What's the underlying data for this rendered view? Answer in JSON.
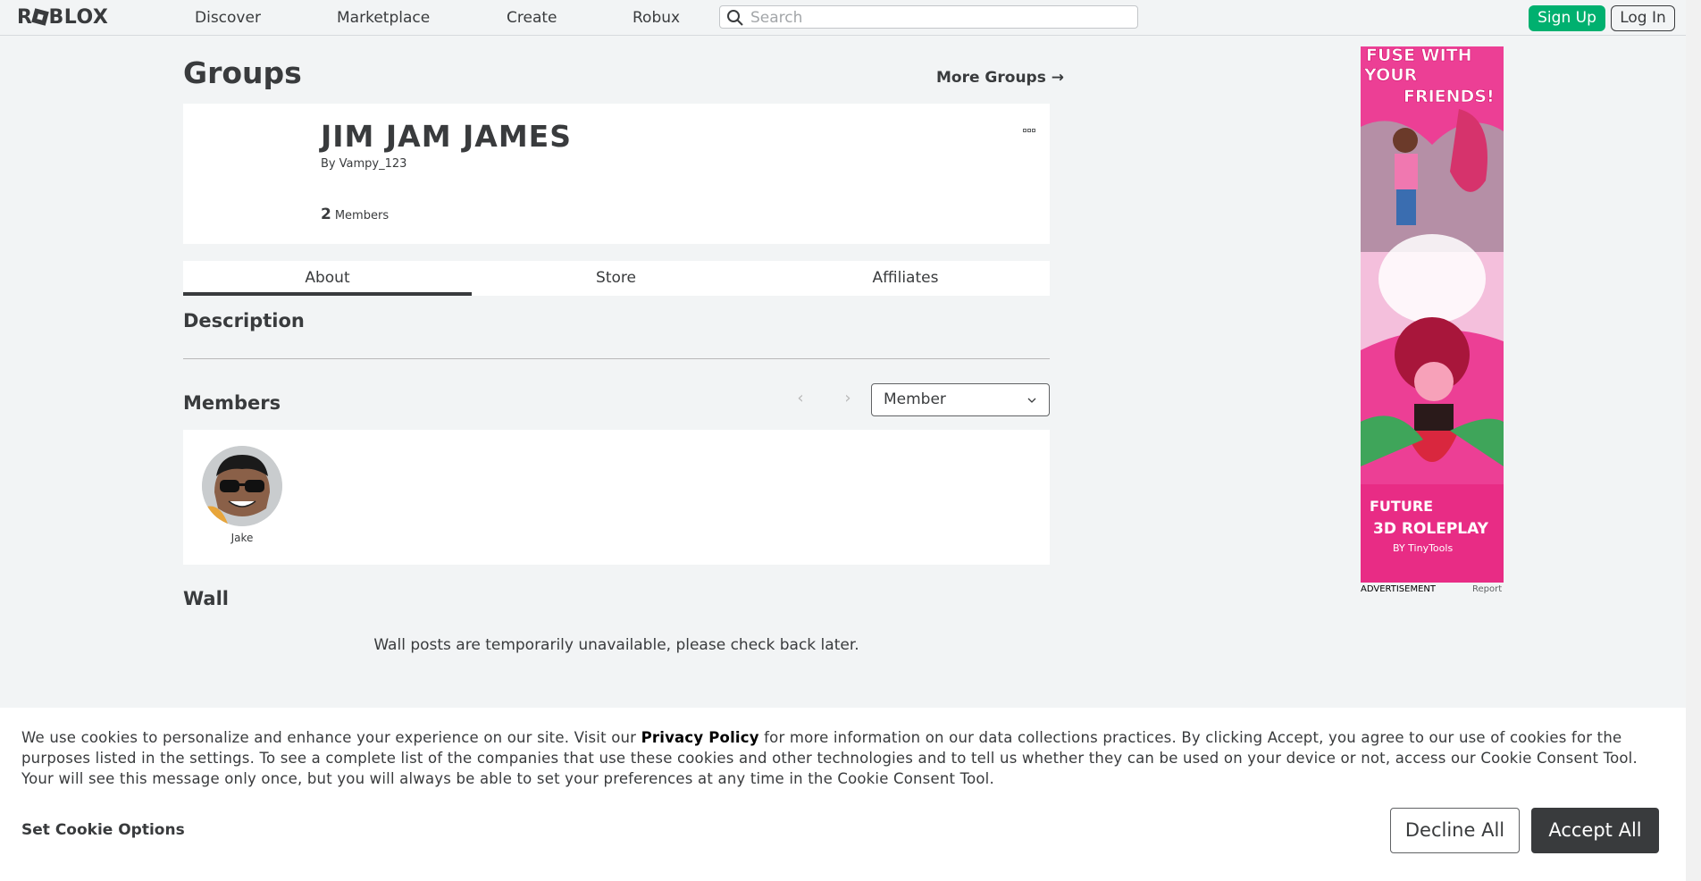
{
  "nav": {
    "logo": "ROBLOX",
    "links": [
      "Discover",
      "Marketplace",
      "Create",
      "Robux"
    ],
    "search_placeholder": "Search",
    "signup": "Sign Up",
    "login": "Log In"
  },
  "page": {
    "title": "Groups",
    "more_groups": "More Groups →"
  },
  "group": {
    "name": "JIM JAM JAMES",
    "by_label": "By",
    "owner": "Vampy_123",
    "member_count": "2",
    "members_label": "Members"
  },
  "tabs": [
    {
      "label": "About",
      "active": true
    },
    {
      "label": "Store",
      "active": false
    },
    {
      "label": "Affiliates",
      "active": false
    }
  ],
  "sections": {
    "description": "Description",
    "members": "Members",
    "wall": "Wall"
  },
  "members": {
    "role_filter": "Member",
    "list": [
      {
        "name": "Jake"
      }
    ]
  },
  "wall": {
    "message": "Wall posts are temporarily unavailable, please check back later."
  },
  "ad": {
    "headline": "FUSE WITH YOUR FRIENDS!",
    "game_title": "FUTURE 3D ROLEPLAY",
    "by_line": "BY TinyTools",
    "footer_left": "ADVERTISEMENT",
    "footer_right": "Report"
  },
  "cookie": {
    "text_before": "We use cookies to personalize and enhance your experience on our site. Visit our ",
    "privacy_link": "Privacy Policy",
    "text_after": " for more information on our data collections practices. By clicking Accept, you agree to our use of cookies for the purposes listed in the settings. To see a complete list of the companies that use these cookies and other technologies and to tell us whether they can be used on your device or not, access our Cookie Consent Tool. Your will see this message only once, but you will always be able to set your preferences at any time in the Cookie Consent Tool.",
    "set_options": "Set Cookie Options",
    "decline": "Decline All",
    "accept": "Accept All"
  },
  "colors": {
    "signup_green": "#00b06f",
    "text_dark": "#393b3d",
    "page_bg": "#f2f4f5"
  }
}
